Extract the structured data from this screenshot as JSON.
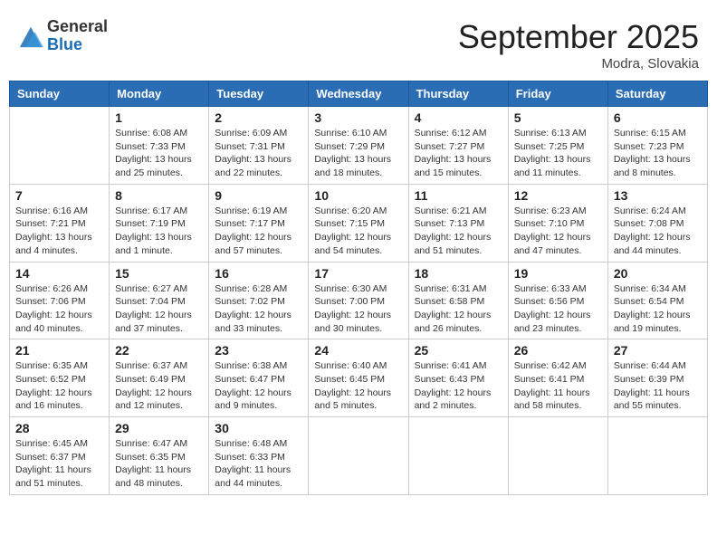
{
  "header": {
    "logo_general": "General",
    "logo_blue": "Blue",
    "title": "September 2025",
    "location": "Modra, Slovakia"
  },
  "weekdays": [
    "Sunday",
    "Monday",
    "Tuesday",
    "Wednesday",
    "Thursday",
    "Friday",
    "Saturday"
  ],
  "weeks": [
    [
      {
        "day": "",
        "sunrise": "",
        "sunset": "",
        "daylight": ""
      },
      {
        "day": "1",
        "sunrise": "Sunrise: 6:08 AM",
        "sunset": "Sunset: 7:33 PM",
        "daylight": "Daylight: 13 hours and 25 minutes."
      },
      {
        "day": "2",
        "sunrise": "Sunrise: 6:09 AM",
        "sunset": "Sunset: 7:31 PM",
        "daylight": "Daylight: 13 hours and 22 minutes."
      },
      {
        "day": "3",
        "sunrise": "Sunrise: 6:10 AM",
        "sunset": "Sunset: 7:29 PM",
        "daylight": "Daylight: 13 hours and 18 minutes."
      },
      {
        "day": "4",
        "sunrise": "Sunrise: 6:12 AM",
        "sunset": "Sunset: 7:27 PM",
        "daylight": "Daylight: 13 hours and 15 minutes."
      },
      {
        "day": "5",
        "sunrise": "Sunrise: 6:13 AM",
        "sunset": "Sunset: 7:25 PM",
        "daylight": "Daylight: 13 hours and 11 minutes."
      },
      {
        "day": "6",
        "sunrise": "Sunrise: 6:15 AM",
        "sunset": "Sunset: 7:23 PM",
        "daylight": "Daylight: 13 hours and 8 minutes."
      }
    ],
    [
      {
        "day": "7",
        "sunrise": "Sunrise: 6:16 AM",
        "sunset": "Sunset: 7:21 PM",
        "daylight": "Daylight: 13 hours and 4 minutes."
      },
      {
        "day": "8",
        "sunrise": "Sunrise: 6:17 AM",
        "sunset": "Sunset: 7:19 PM",
        "daylight": "Daylight: 13 hours and 1 minute."
      },
      {
        "day": "9",
        "sunrise": "Sunrise: 6:19 AM",
        "sunset": "Sunset: 7:17 PM",
        "daylight": "Daylight: 12 hours and 57 minutes."
      },
      {
        "day": "10",
        "sunrise": "Sunrise: 6:20 AM",
        "sunset": "Sunset: 7:15 PM",
        "daylight": "Daylight: 12 hours and 54 minutes."
      },
      {
        "day": "11",
        "sunrise": "Sunrise: 6:21 AM",
        "sunset": "Sunset: 7:13 PM",
        "daylight": "Daylight: 12 hours and 51 minutes."
      },
      {
        "day": "12",
        "sunrise": "Sunrise: 6:23 AM",
        "sunset": "Sunset: 7:10 PM",
        "daylight": "Daylight: 12 hours and 47 minutes."
      },
      {
        "day": "13",
        "sunrise": "Sunrise: 6:24 AM",
        "sunset": "Sunset: 7:08 PM",
        "daylight": "Daylight: 12 hours and 44 minutes."
      }
    ],
    [
      {
        "day": "14",
        "sunrise": "Sunrise: 6:26 AM",
        "sunset": "Sunset: 7:06 PM",
        "daylight": "Daylight: 12 hours and 40 minutes."
      },
      {
        "day": "15",
        "sunrise": "Sunrise: 6:27 AM",
        "sunset": "Sunset: 7:04 PM",
        "daylight": "Daylight: 12 hours and 37 minutes."
      },
      {
        "day": "16",
        "sunrise": "Sunrise: 6:28 AM",
        "sunset": "Sunset: 7:02 PM",
        "daylight": "Daylight: 12 hours and 33 minutes."
      },
      {
        "day": "17",
        "sunrise": "Sunrise: 6:30 AM",
        "sunset": "Sunset: 7:00 PM",
        "daylight": "Daylight: 12 hours and 30 minutes."
      },
      {
        "day": "18",
        "sunrise": "Sunrise: 6:31 AM",
        "sunset": "Sunset: 6:58 PM",
        "daylight": "Daylight: 12 hours and 26 minutes."
      },
      {
        "day": "19",
        "sunrise": "Sunrise: 6:33 AM",
        "sunset": "Sunset: 6:56 PM",
        "daylight": "Daylight: 12 hours and 23 minutes."
      },
      {
        "day": "20",
        "sunrise": "Sunrise: 6:34 AM",
        "sunset": "Sunset: 6:54 PM",
        "daylight": "Daylight: 12 hours and 19 minutes."
      }
    ],
    [
      {
        "day": "21",
        "sunrise": "Sunrise: 6:35 AM",
        "sunset": "Sunset: 6:52 PM",
        "daylight": "Daylight: 12 hours and 16 minutes."
      },
      {
        "day": "22",
        "sunrise": "Sunrise: 6:37 AM",
        "sunset": "Sunset: 6:49 PM",
        "daylight": "Daylight: 12 hours and 12 minutes."
      },
      {
        "day": "23",
        "sunrise": "Sunrise: 6:38 AM",
        "sunset": "Sunset: 6:47 PM",
        "daylight": "Daylight: 12 hours and 9 minutes."
      },
      {
        "day": "24",
        "sunrise": "Sunrise: 6:40 AM",
        "sunset": "Sunset: 6:45 PM",
        "daylight": "Daylight: 12 hours and 5 minutes."
      },
      {
        "day": "25",
        "sunrise": "Sunrise: 6:41 AM",
        "sunset": "Sunset: 6:43 PM",
        "daylight": "Daylight: 12 hours and 2 minutes."
      },
      {
        "day": "26",
        "sunrise": "Sunrise: 6:42 AM",
        "sunset": "Sunset: 6:41 PM",
        "daylight": "Daylight: 11 hours and 58 minutes."
      },
      {
        "day": "27",
        "sunrise": "Sunrise: 6:44 AM",
        "sunset": "Sunset: 6:39 PM",
        "daylight": "Daylight: 11 hours and 55 minutes."
      }
    ],
    [
      {
        "day": "28",
        "sunrise": "Sunrise: 6:45 AM",
        "sunset": "Sunset: 6:37 PM",
        "daylight": "Daylight: 11 hours and 51 minutes."
      },
      {
        "day": "29",
        "sunrise": "Sunrise: 6:47 AM",
        "sunset": "Sunset: 6:35 PM",
        "daylight": "Daylight: 11 hours and 48 minutes."
      },
      {
        "day": "30",
        "sunrise": "Sunrise: 6:48 AM",
        "sunset": "Sunset: 6:33 PM",
        "daylight": "Daylight: 11 hours and 44 minutes."
      },
      {
        "day": "",
        "sunrise": "",
        "sunset": "",
        "daylight": ""
      },
      {
        "day": "",
        "sunrise": "",
        "sunset": "",
        "daylight": ""
      },
      {
        "day": "",
        "sunrise": "",
        "sunset": "",
        "daylight": ""
      },
      {
        "day": "",
        "sunrise": "",
        "sunset": "",
        "daylight": ""
      }
    ]
  ]
}
